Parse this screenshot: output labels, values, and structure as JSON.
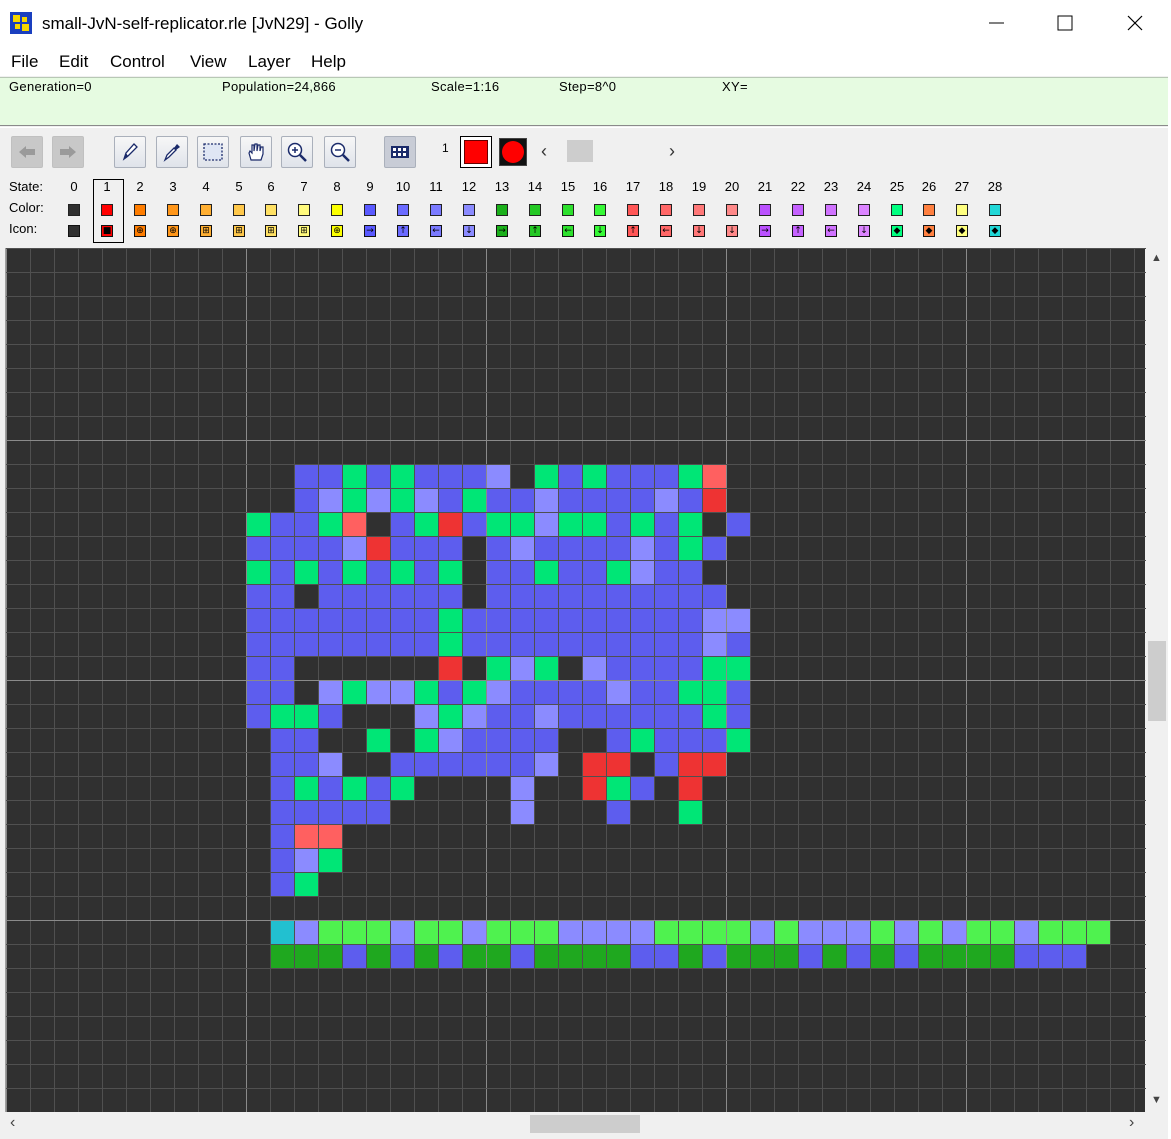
{
  "window": {
    "title": "small-JvN-self-replicator.rle [JvN29] - Golly",
    "app_icon": "golly-app-icon",
    "controls": [
      "minimize-icon",
      "maximize-icon",
      "close-icon"
    ]
  },
  "menu": [
    "File",
    "Edit",
    "Control",
    "View",
    "Layer",
    "Help"
  ],
  "status": {
    "generation": "Generation=0",
    "population": "Population=24,866",
    "scale": "Scale=1:16",
    "step": "Step=8^0",
    "xy": "XY="
  },
  "toolbar": {
    "buttons": [
      {
        "name": "undo-button",
        "icon": "left-arrow-icon",
        "enabled": false
      },
      {
        "name": "redo-button",
        "icon": "right-arrow-icon",
        "enabled": false
      },
      {
        "name": "draw-button",
        "icon": "pencil-icon",
        "enabled": true
      },
      {
        "name": "pick-button",
        "icon": "eyedropper-icon",
        "enabled": true
      },
      {
        "name": "select-button",
        "icon": "selection-icon",
        "enabled": true
      },
      {
        "name": "move-button",
        "icon": "hand-icon",
        "enabled": true
      },
      {
        "name": "zoom-in-button",
        "icon": "zoom-in-icon",
        "enabled": true
      },
      {
        "name": "zoom-out-button",
        "icon": "zoom-out-icon",
        "enabled": true
      },
      {
        "name": "all-states-button",
        "icon": "states-grid-icon",
        "enabled": true
      }
    ],
    "current_state": "1",
    "current_state_color": "#ff0000"
  },
  "states": {
    "labels": {
      "state": "State:",
      "color": "Color:",
      "icon": "Icon:"
    },
    "selected": 1,
    "numbers": [
      "0",
      "1",
      "2",
      "3",
      "4",
      "5",
      "6",
      "7",
      "8",
      "9",
      "10",
      "11",
      "12",
      "13",
      "14",
      "15",
      "16",
      "17",
      "18",
      "19",
      "20",
      "21",
      "22",
      "23",
      "24",
      "25",
      "26",
      "27",
      "28"
    ],
    "colors": [
      "#303030",
      "#ff0000",
      "#ff7d00",
      "#ff9619",
      "#ffaf32",
      "#ffc84b",
      "#ffe164",
      "#fffa7d",
      "#fbff00",
      "#5959ff",
      "#6a6aff",
      "#7a7aff",
      "#8b8bff",
      "#1bb01b",
      "#24c824",
      "#2de02d",
      "#36f836",
      "#ff5656",
      "#ff6767",
      "#ff7878",
      "#ff8989",
      "#ba51ff",
      "#c562ff",
      "#d073ff",
      "#db84ff",
      "#00ff80",
      "#ff8040",
      "#ffff80",
      "#21d7d7"
    ],
    "icon_glyphs": [
      "",
      "■",
      "⊕",
      "⊕",
      "⊞",
      "⊞",
      "⊞",
      "⊞",
      "⊕",
      "→",
      "↑",
      "←",
      "↓",
      "→",
      "↑",
      "←",
      "↓",
      "↑",
      "←",
      "↓",
      "↓",
      "→",
      "↑",
      "←",
      "↓",
      "◆",
      "◆",
      "◆",
      "◆"
    ]
  },
  "grid": {
    "cell_colors": {
      "B": "#5d5dee",
      "b": "#8b8bff",
      "G": "#00e676",
      "R": "#ee3333",
      "r": "#ff6060",
      "L": "#4ff24f",
      "D": "#1fa81f",
      "C": "#22c0d0"
    },
    "pattern": [
      "..............................................",
      "..............................................",
      "..............................................",
      "..............................................",
      "..............................................",
      "..............................................",
      "..............................................",
      "..............................................",
      "..............................................",
      "............BBGBGBBBb.GBGBBBGr................",
      "............BbGbGbBGBBbBBBBbBR................",
      "..........GBBGr.BGRBGGbGGBGBG.B...............",
      "..........BBBBbRBBB.BbBBBBbBGB................",
      "..........GBGBGBGBG.BBGBBGbBB.................",
      "..........BB.BBBBBB.BBBBBBBBBB................",
      "..........BBBBBBBBGBBBBBBBBBBbb...............",
      "..........BBBBBBBBGBBBBBBBBBBbB...............",
      "..........BB......R.GbG.bBBBBGG...............",
      "..........BB.bGbbGBGbBBBBbBBGGB...............",
      "..........BGGB...bGbBBbBBBBBBGB...............",
      "...........BB..G.GbBBBB..BGBBBG...............",
      "...........BBb..BBBBBBb.RR.BRR................",
      "...........BGBGBG....b..RGB.R.................",
      "...........BBBBB.....b...B..G.................",
      "...........Brr................................",
      "...........BbG................................",
      "...........BG.................................",
      "..............................................",
      "...........CbLLLbLLbLLLbbbbLLLLbLbbbLbLbLLbLLL",
      "...........DDDBDBDBDDBDDDDBBDBDDDBDBDBDDDDBBB",
      "..............................................",
      "..............................................",
      "..............................................",
      "..............................................",
      "..............................................",
      ".............................................."
    ]
  }
}
